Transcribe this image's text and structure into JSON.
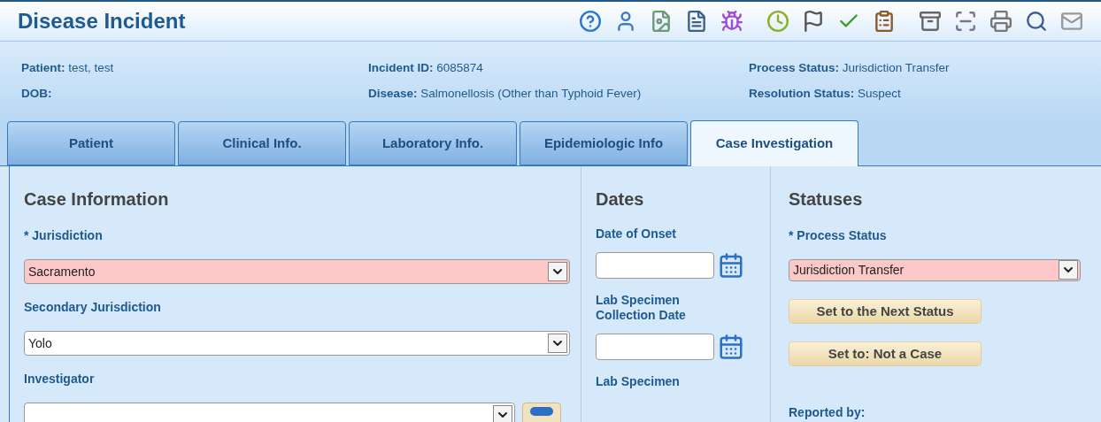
{
  "title": "Disease Incident",
  "info": [
    {
      "label": "Patient:",
      "value": "test, test"
    },
    {
      "label": "Incident ID:",
      "value": "6085874"
    },
    {
      "label": "Process Status:",
      "value": "Jurisdiction Transfer"
    },
    {
      "label": "DOB:"
    },
    {
      "label": "Disease:",
      "value": "Salmonellosis (Other than Typhoid Fever)"
    },
    {
      "label": "Resolution Status:",
      "value": "Suspect"
    }
  ],
  "tabs": [
    {
      "label": "Patient",
      "selected": false
    },
    {
      "label": "Clinical Info.",
      "selected": false
    },
    {
      "label": "Laboratory Info.",
      "selected": false
    },
    {
      "label": "Epidemiologic Info",
      "selected": false
    },
    {
      "label": "Case Investigation",
      "selected": true
    }
  ],
  "case_information": {
    "heading": "Case Information",
    "fields": [
      {
        "label": "* Jurisdiction",
        "value": "Sacramento",
        "required": true
      },
      {
        "label": "Secondary Jurisdiction",
        "value": "Yolo",
        "required": false
      },
      {
        "label": "Investigator",
        "required": false,
        "lookup": true
      }
    ]
  },
  "dates": {
    "heading": "Dates",
    "fields": [
      {
        "label": "Date of Onset"
      },
      {
        "label": "Lab Specimen Collection Date"
      },
      {
        "label": "Lab Specimen"
      }
    ]
  },
  "statuses": {
    "heading": "Statuses",
    "process_status": {
      "label": "* Process Status",
      "value": "Jurisdiction Transfer",
      "required": true
    },
    "buttons": [
      "Set to the Next Status",
      "Set to: Not a Case"
    ],
    "reported_by": "Reported by:"
  }
}
